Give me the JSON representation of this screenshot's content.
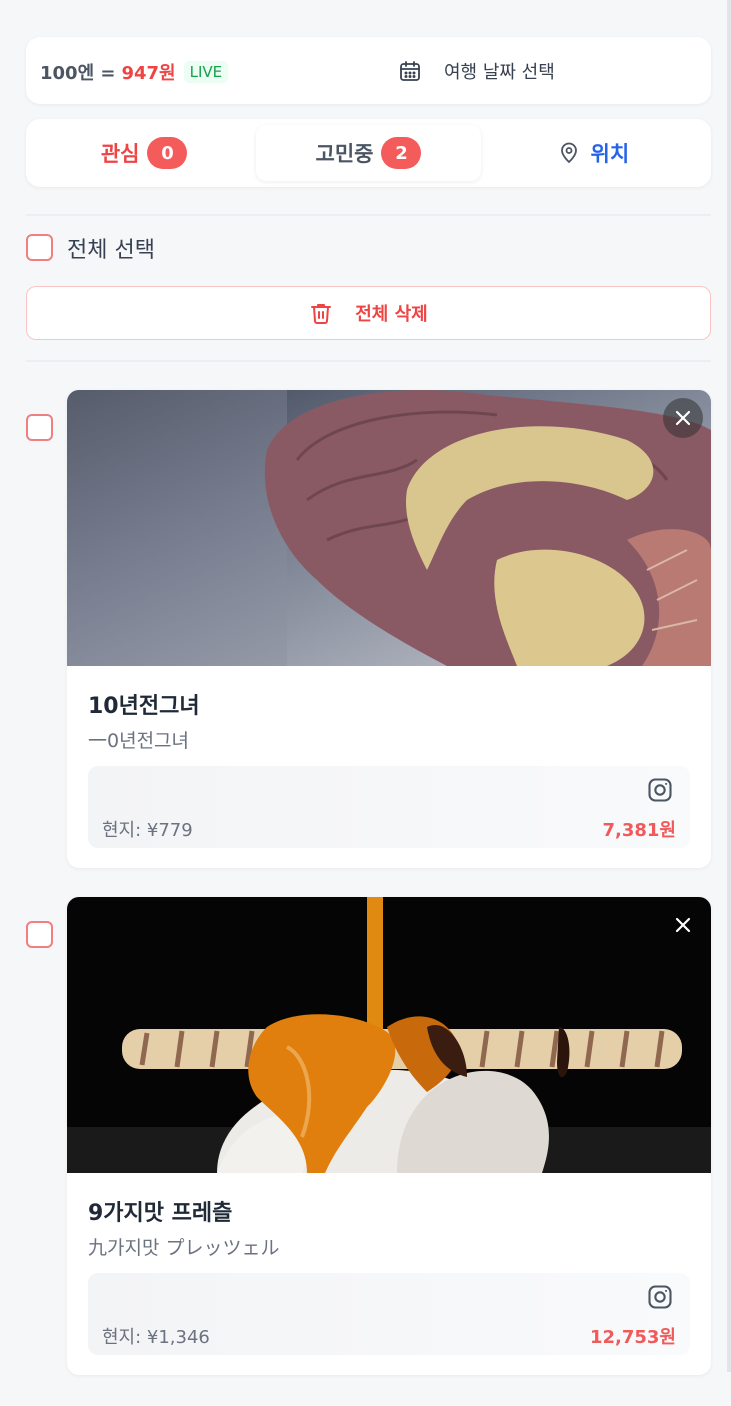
{
  "rate": {
    "base": "100엔 =",
    "value": "947원",
    "live": "LIVE"
  },
  "date_picker": {
    "label": "여행 날짜 선택"
  },
  "tabs": [
    {
      "label": "관심",
      "count": "0"
    },
    {
      "label": "고민중",
      "count": "2"
    },
    {
      "label": "위치"
    }
  ],
  "select_all": {
    "label": "전체 선택"
  },
  "delete_all": {
    "label": "전체 삭제"
  },
  "items": [
    {
      "title": "10년전그녀",
      "subtitle": "一0년전그녀",
      "local_price": "현지: ¥779",
      "krw_price": "7,381원"
    },
    {
      "title": "9가지맛 프레츨",
      "subtitle": "九가지맛 プレッツェル",
      "local_price": "현지: ¥1,346",
      "krw_price": "12,753원"
    }
  ],
  "colors": {
    "accent_red": "#ef4444",
    "accent_blue": "#2563eb",
    "live_green": "#16a34a"
  }
}
